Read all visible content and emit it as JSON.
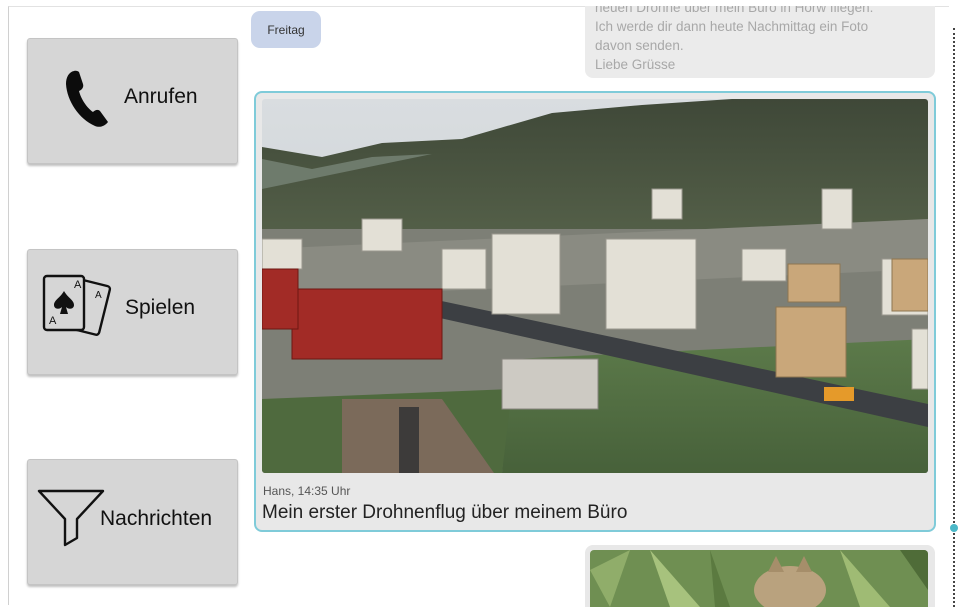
{
  "sidebar": {
    "buttons": [
      {
        "label": "Anrufen",
        "icon": "phone-icon"
      },
      {
        "label": "Spielen",
        "icon": "playing-cards-icon"
      },
      {
        "label": "Nachrichten",
        "icon": "filter-icon"
      }
    ]
  },
  "chat": {
    "day_label": "Freitag",
    "previous_message": {
      "lines": [
        "neuen Drohne über mein Büro in Horw fliegen.",
        "Ich werde dir dann heute Nachmittag ein Foto",
        "davon senden.",
        "Liebe Grüsse"
      ]
    },
    "photo_message": {
      "meta": "Hans, 14:35 Uhr",
      "caption": "Mein erster Drohnenflug über meinem Büro",
      "image": "aerial-town-photo"
    },
    "next_message": {
      "image": "cat-in-grass-photo"
    }
  },
  "colors": {
    "button_bg": "#d6d6d6",
    "day_chip_bg": "#c9d4ea",
    "selected_border": "#7fcbd9",
    "bubble_bg": "#e8e8e8"
  }
}
